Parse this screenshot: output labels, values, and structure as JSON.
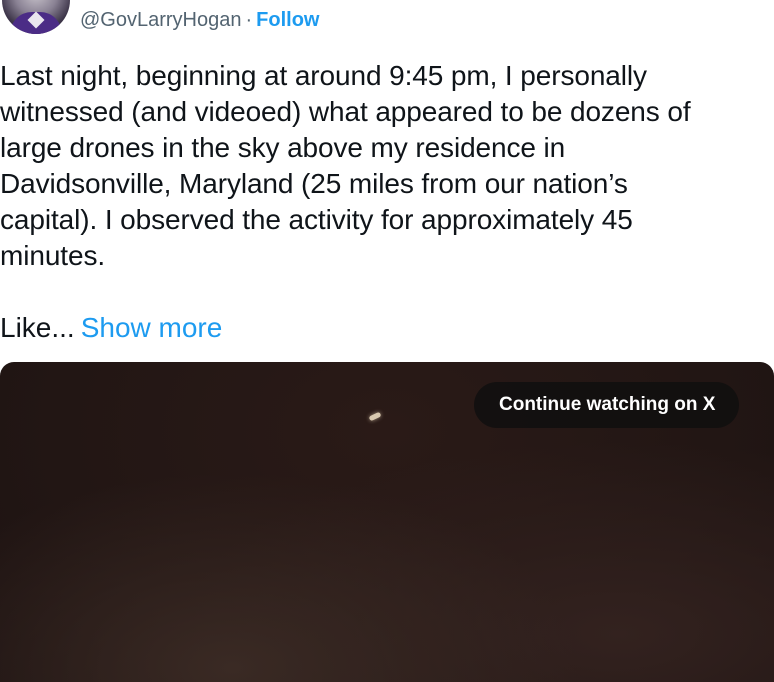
{
  "header": {
    "handle": "@GovLarryHogan",
    "separator": "·",
    "follow_label": "Follow"
  },
  "tweet": {
    "text": "Last night, beginning at around 9:45 pm, I personally\nwitnessed (and videoed) what appeared to be dozens of\nlarge drones in the sky above my residence in\nDavidsonville, Maryland (25 miles from our nation’s\ncapital). I observed the activity for approximately 45\nminutes.",
    "truncated_text": "Like...",
    "show_more_label": "Show more"
  },
  "video": {
    "continue_label": "Continue watching on X"
  },
  "colors": {
    "link": "#1d9bf0",
    "text": "#0f1419",
    "secondary": "#536471"
  }
}
